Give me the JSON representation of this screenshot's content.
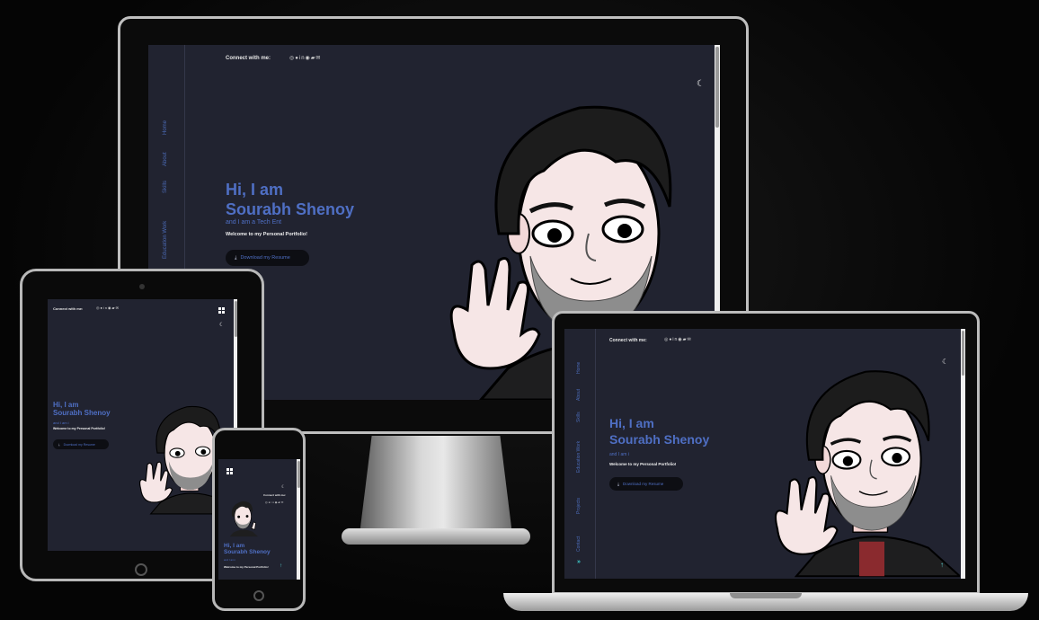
{
  "site": {
    "connect_label": "Connect with me:",
    "social_icons": [
      "instagram-icon",
      "github-icon",
      "linkedin-icon",
      "whatsapp-icon",
      "discord-icon",
      "email-icon"
    ],
    "social_glyphs": "◎●in◉▰✉",
    "hi_line": "Hi, I am",
    "name_line": "Sourabh Shenoy",
    "tagline_monitor": "and I am a Tech Ent",
    "tagline_short": "and I am i",
    "welcome": "Welcome to my Personal Portfolio!",
    "download_label": "Download my Resume",
    "nav": {
      "home": "Home",
      "about": "About",
      "skills": "Skills",
      "education": "Education Work",
      "projects": "Projects",
      "contact": "Contact"
    }
  },
  "colors": {
    "screen_bg": "#212330",
    "accent": "#4f6fc4",
    "teal": "#3fd0d0"
  }
}
